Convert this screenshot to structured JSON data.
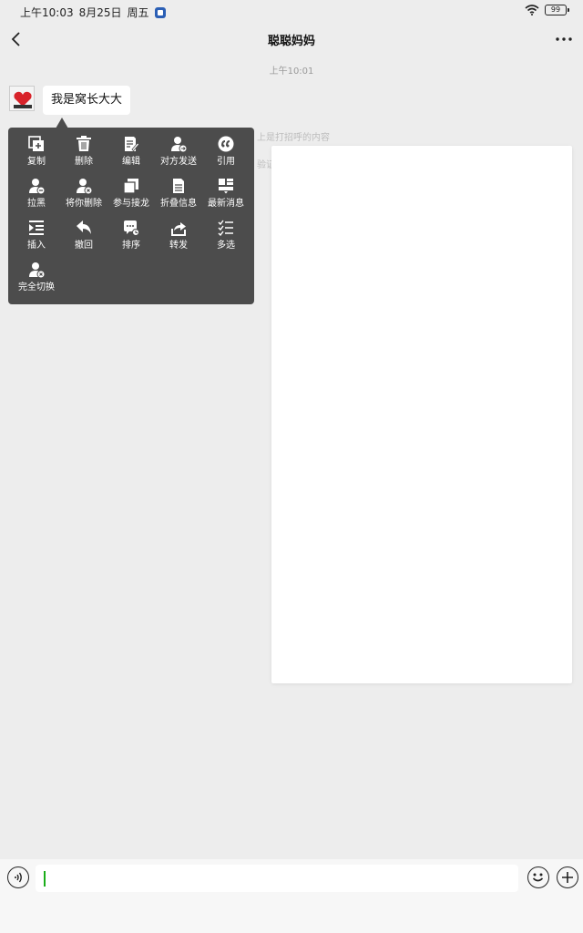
{
  "status_bar": {
    "time": "上午10:03",
    "date": "8月25日",
    "weekday": "周五",
    "battery": "99"
  },
  "nav": {
    "title": "聪聪妈妈",
    "back_icon": "chevron-left-icon",
    "more_icon": "more-dots-icon"
  },
  "chat": {
    "timestamp": "上午10:01",
    "message_text": "我是窝长大大"
  },
  "menu": {
    "items": [
      {
        "label": "复制",
        "icon": "copy-icon"
      },
      {
        "label": "删除",
        "icon": "trash-icon"
      },
      {
        "label": "编辑",
        "icon": "edit-icon"
      },
      {
        "label": "对方发送",
        "icon": "user-send-icon"
      },
      {
        "label": "引用",
        "icon": "quote-icon"
      },
      {
        "label": "拉黑",
        "icon": "user-block-icon"
      },
      {
        "label": "将你删除",
        "icon": "user-delete-icon"
      },
      {
        "label": "参与接龙",
        "icon": "chain-icon"
      },
      {
        "label": "折叠信息",
        "icon": "fold-icon"
      },
      {
        "label": "最新消息",
        "icon": "latest-message-icon"
      },
      {
        "label": "插入",
        "icon": "insert-icon"
      },
      {
        "label": "撤回",
        "icon": "undo-icon"
      },
      {
        "label": "排序",
        "icon": "sort-icon"
      },
      {
        "label": "转发",
        "icon": "forward-icon"
      },
      {
        "label": "多选",
        "icon": "multi-select-icon"
      },
      {
        "label": "完全切换",
        "icon": "user-switch-icon"
      }
    ]
  },
  "input": {
    "value": "",
    "placeholder": ""
  },
  "colors": {
    "background": "#ededed",
    "menu_bg": "#4c4c4c",
    "bubble_bg": "#ffffff",
    "accent_cursor": "#1aad19"
  }
}
